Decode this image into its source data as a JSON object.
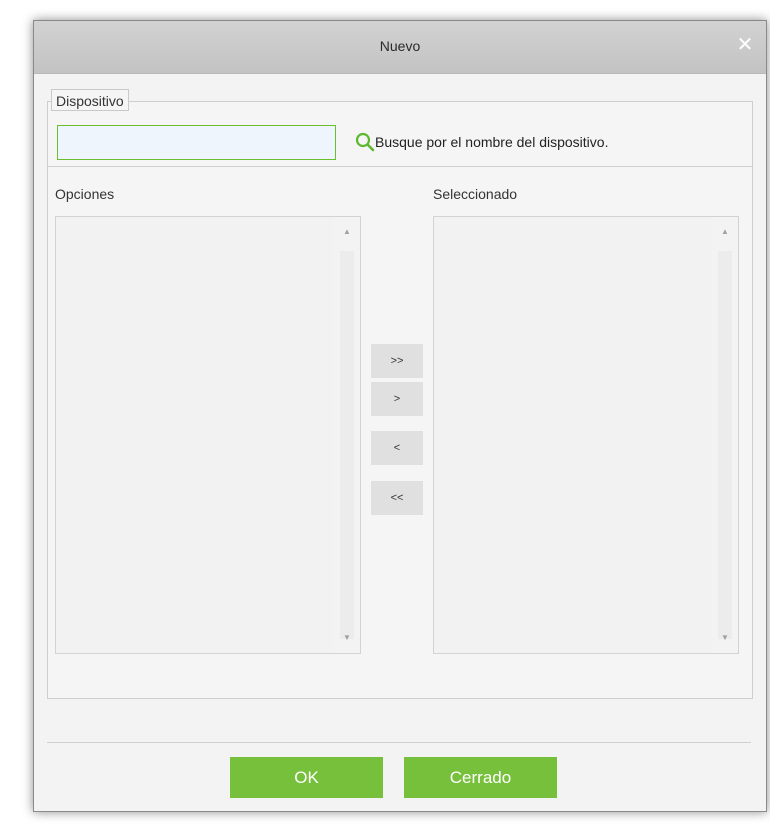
{
  "dialog": {
    "title": "Nuevo",
    "close_symbol": "✕"
  },
  "device_section": {
    "legend": "Dispositivo",
    "search_value": "",
    "search_hint": "Busque por el nombre del dispositivo."
  },
  "lists": {
    "options_label": "Opciones",
    "selected_label": "Seleccionado",
    "options_items": [],
    "selected_items": []
  },
  "move_buttons": {
    "add_all": ">>",
    "add_one": ">",
    "remove_one": "<",
    "remove_all": "<<"
  },
  "footer": {
    "ok_label": "OK",
    "close_label": "Cerrado"
  },
  "colors": {
    "accent_green": "#77c03b",
    "titlebar_gray": "#c8c8c8"
  },
  "icons": {
    "close": "close-icon",
    "search": "search-icon",
    "scroll_up": "scroll-up-arrow-icon",
    "scroll_down": "scroll-down-arrow-icon"
  }
}
